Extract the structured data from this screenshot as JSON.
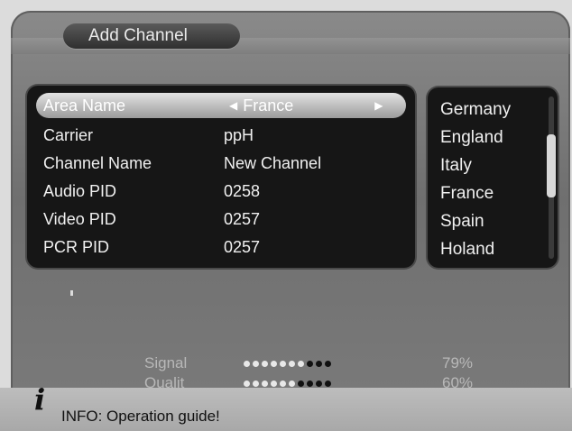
{
  "title": "Add Channel",
  "fields": [
    {
      "label": "Area Name",
      "value": "France",
      "selected": true
    },
    {
      "label": "Carrier",
      "value": "ppH"
    },
    {
      "label": "Channel Name",
      "value": "New Channel"
    },
    {
      "label": "Audio PID",
      "value": "0258"
    },
    {
      "label": "Video PID",
      "value": "0257"
    },
    {
      "label": "PCR PID",
      "value": "0257"
    }
  ],
  "area_list": [
    "Germany",
    "England",
    "Italy",
    "France",
    "Spain",
    "Holand"
  ],
  "status": {
    "signal": {
      "label": "Signal",
      "percent_text": "79%",
      "dots_on": 7,
      "dots_total": 10
    },
    "quality": {
      "label": "Qualit",
      "percent_text": "60%",
      "dots_on": 6,
      "dots_total": 10
    }
  },
  "info": {
    "icon": "info-icon",
    "text": "INFO: Operation guide!"
  }
}
